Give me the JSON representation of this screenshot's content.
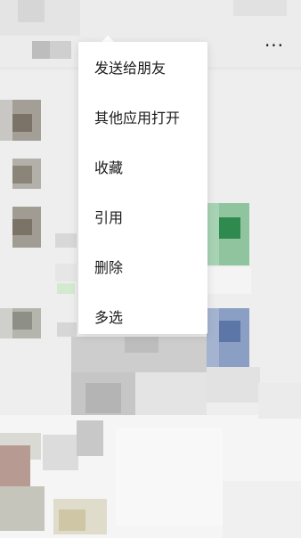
{
  "header": {
    "more_icon": "more-dots-icon",
    "more_glyph": "···"
  },
  "context_menu": {
    "items": [
      {
        "label": "发送给朋友"
      },
      {
        "label": "其他应用打开"
      },
      {
        "label": "收藏"
      },
      {
        "label": "引用"
      },
      {
        "label": "删除"
      },
      {
        "label": "多选"
      }
    ]
  }
}
